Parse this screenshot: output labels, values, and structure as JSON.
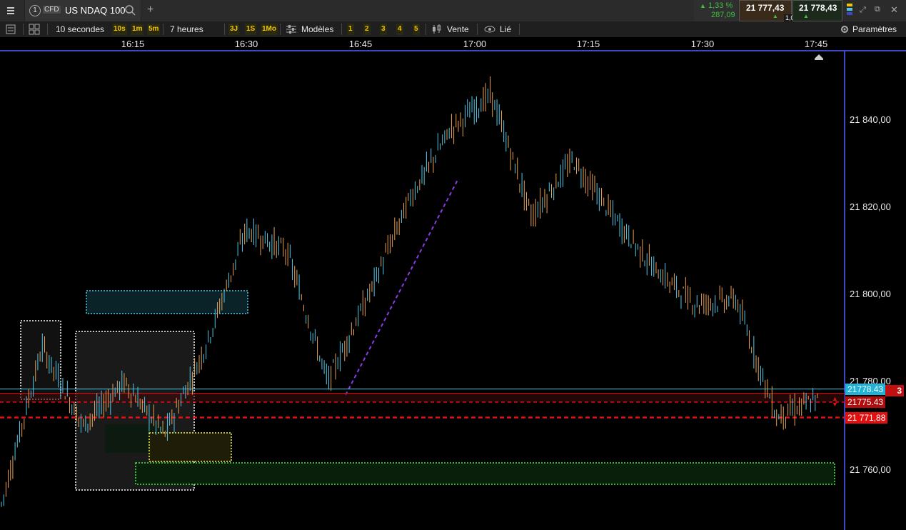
{
  "tab": {
    "number": "1",
    "badge": "CFD",
    "title": "US NDAQ 100",
    "add": "+"
  },
  "quote": {
    "change_pct": "1,33 %",
    "change_abs": "287,09",
    "sell_price": "21 777,43",
    "buy_price": "21 778,43",
    "spread": "1,00",
    "up_color": "#3fbf3f"
  },
  "toolbar": {
    "interval": "10 secondes",
    "interval_buttons": [
      "10s",
      "1m",
      "5m"
    ],
    "range": "7 heures",
    "range_buttons": [
      "3J",
      "1S",
      "1Mo"
    ],
    "models": "Modèles",
    "model_buttons": [
      "1",
      "2",
      "3",
      "4",
      "5"
    ],
    "sell": "Vente",
    "linked": "Lié",
    "settings": "Paramètres"
  },
  "time_axis": [
    "16:15",
    "16:30",
    "16:45",
    "17:00",
    "17:15",
    "17:30",
    "17:45"
  ],
  "price_axis": [
    "21 840,00",
    "21 820,00",
    "21 800,00",
    "21 780,00",
    "21 760,00"
  ],
  "price_labels": {
    "current": "21778.43",
    "level": "21775.43",
    "dashed": "21 771,88",
    "truncated": "3"
  },
  "colors": {
    "accent_blue": "#3c48c8",
    "cyan": "#4fc8e8",
    "red": "#e01010",
    "candle_up": "#4fc8e8",
    "candle_down": "#e8a050"
  },
  "chart_data": {
    "type": "line",
    "title": "",
    "xlabel": "",
    "ylabel": "",
    "x": [
      "16:05",
      "16:10",
      "16:15",
      "16:20",
      "16:25",
      "16:30",
      "16:35",
      "16:40",
      "16:45",
      "16:50",
      "16:55",
      "17:00",
      "17:05",
      "17:10",
      "17:15",
      "17:20",
      "17:25",
      "17:30",
      "17:35",
      "17:40",
      "17:45"
    ],
    "series": [
      {
        "values": [
          21752,
          21788,
          21770,
          21780,
          21768,
          21788,
          21815,
          21810,
          21780,
          21800,
          21822,
          21838,
          21846,
          21818,
          21831,
          21818,
          21806,
          21798,
          21799,
          21772,
          21776
        ]
      }
    ],
    "ylim": [
      21750,
      21852
    ],
    "horizontal_lines": [
      21778.43,
      21777.43,
      21775.43,
      21771.88
    ]
  }
}
